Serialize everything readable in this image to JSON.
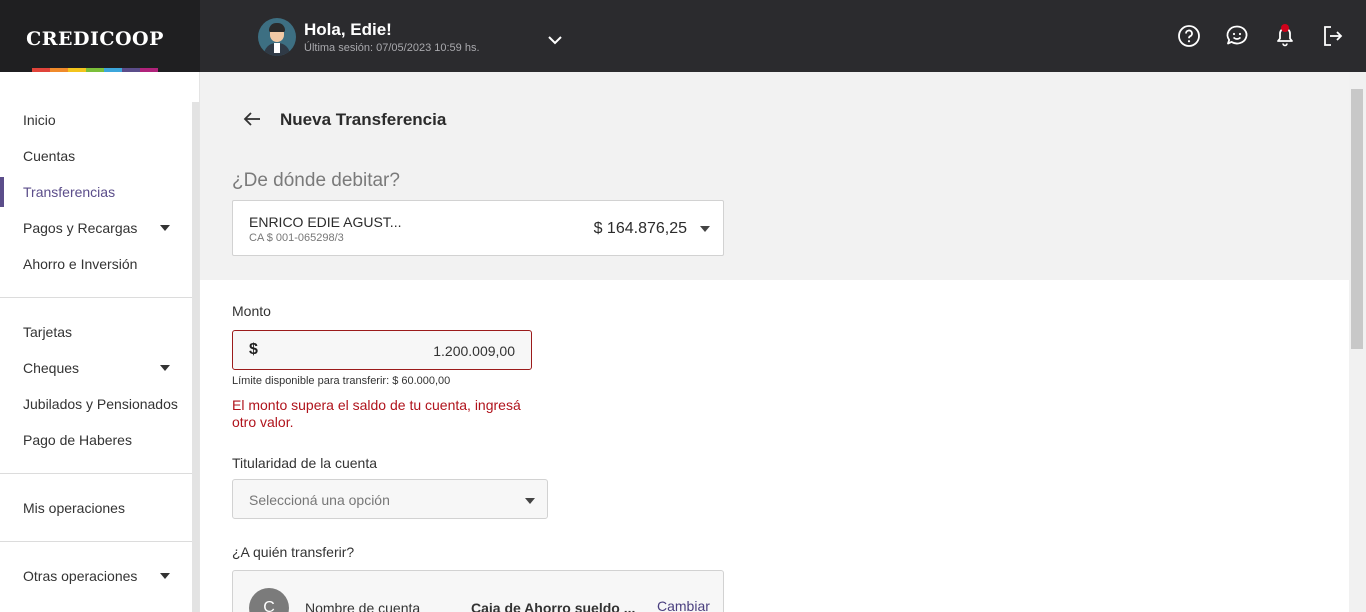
{
  "brand": {
    "name": "CREDICOOP",
    "stripe_colors": [
      "#e0443a",
      "#f08a2b",
      "#f3c41c",
      "#7bbf3a",
      "#3ca6db",
      "#5b4d8a",
      "#b0237b"
    ]
  },
  "header": {
    "greeting": "Hola, Edie!",
    "last_session": "Última sesión: 07/05/2023 10:59 hs.",
    "icons": [
      "help-icon",
      "chat-icon",
      "bell-icon",
      "logout-icon"
    ]
  },
  "sidebar": {
    "group1": [
      {
        "label": "Inicio",
        "active": false,
        "has_submenu": false
      },
      {
        "label": "Cuentas",
        "active": false,
        "has_submenu": false
      },
      {
        "label": "Transferencias",
        "active": true,
        "has_submenu": false
      },
      {
        "label": "Pagos y Recargas",
        "active": false,
        "has_submenu": true
      },
      {
        "label": "Ahorro e Inversión",
        "active": false,
        "has_submenu": false
      }
    ],
    "group2": [
      {
        "label": "Tarjetas",
        "active": false,
        "has_submenu": false
      },
      {
        "label": "Cheques",
        "active": false,
        "has_submenu": true
      },
      {
        "label": "Jubilados y Pensionados",
        "active": false,
        "has_submenu": false
      },
      {
        "label": "Pago de Haberes",
        "active": false,
        "has_submenu": false
      }
    ],
    "group3": [
      {
        "label": "Mis operaciones",
        "active": false,
        "has_submenu": false
      }
    ],
    "group4": [
      {
        "label": "Otras operaciones",
        "active": false,
        "has_submenu": true
      }
    ]
  },
  "main": {
    "title": "Nueva Transferencia",
    "debit_question": "¿De dónde debitar?",
    "account": {
      "name": "ENRICO EDIE AGUST...",
      "number": "CA $ 001-065298/3",
      "balance": "$ 164.876,25"
    },
    "amount": {
      "label": "Monto",
      "currency": "$",
      "value": "1.200.009,00",
      "limit": "Límite disponible para transferir: $ 60.000,00",
      "error": "El monto supera el saldo de tu cuenta, ingresá otro valor."
    },
    "ownership": {
      "label": "Titularidad de la cuenta",
      "placeholder": "Seleccioná una opción"
    },
    "destination": {
      "question": "¿A quién transferir?",
      "avatar_letter": "C",
      "field_label": "Nombre de cuenta",
      "field_value": "Caja de Ahorro sueldo ...",
      "change_label": "Cambiar"
    }
  }
}
